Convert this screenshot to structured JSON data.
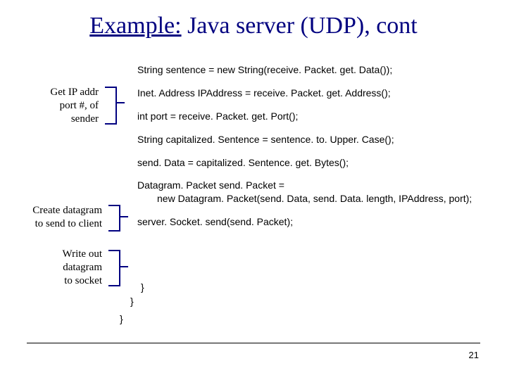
{
  "title": {
    "prefix": "Example:",
    "rest": " Java server (UDP), cont"
  },
  "code": {
    "l1": "String sentence = new String(receive. Packet. get. Data());",
    "l2": "Inet. Address IPAddress = receive. Packet. get. Address();",
    "l3": "int port = receive. Packet. get. Port();",
    "l4": "String capitalized. Sentence = sentence. to. Upper. Case();",
    "l5": "send. Data = capitalized. Sentence. get. Bytes();",
    "l6a": "Datagram. Packet send. Packet =",
    "l6b": "new Datagram. Packet(send. Data, send. Data. length, IPAddress, port);",
    "l7": "server. Socket. send(send. Packet);"
  },
  "braces": {
    "b1": "}",
    "b2": "}",
    "b3": "}"
  },
  "annot": {
    "a1": {
      "l1": "Get IP addr",
      "l2": "port #, of",
      "l3": "sender"
    },
    "a2": {
      "l1": "Create datagram",
      "l2": "to send to client"
    },
    "a3": {
      "l1": "Write out",
      "l2": "datagram",
      "l3": "to socket"
    }
  },
  "page_number": "21"
}
